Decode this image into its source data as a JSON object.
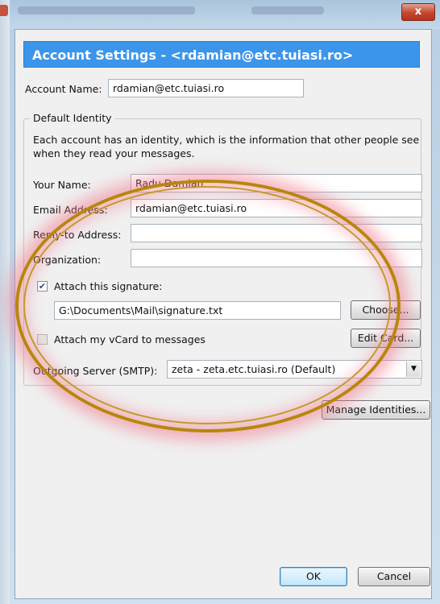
{
  "window": {
    "close_glyph": "x"
  },
  "dialog": {
    "header": "Account Settings - <rdamian@etc.tuiasi.ro>",
    "account_name_label": "Account Name:",
    "account_name_value": "rdamian@etc.tuiasi.ro",
    "identity_legend": "Default Identity",
    "identity_description": "Each account has an identity, which is the information that other people see when they read your messages.",
    "your_name_label": "Your Name:",
    "your_name_value": "Radu Damian",
    "email_label": "Email Address:",
    "email_value": "rdamian@etc.tuiasi.ro",
    "reply_to_label": "Reply-to Address:",
    "reply_to_value": "",
    "organization_label": "Organization:",
    "organization_value": "",
    "attach_signature_label": "Attach this signature:",
    "attach_signature_checked": true,
    "signature_path": "G:\\Documents\\Mail\\signature.txt",
    "choose_button": "Choose...",
    "attach_vcard_label": "Attach my vCard to messages",
    "attach_vcard_checked": false,
    "edit_card_button": "Edit Card...",
    "smtp_label": "Outgoing Server (SMTP):",
    "smtp_value": "zeta - zeta.etc.tuiasi.ro (Default)",
    "manage_identities_button": "Manage Identities...",
    "ok_button": "OK",
    "cancel_button": "Cancel"
  },
  "colors": {
    "header_bg": "#3b95ea",
    "annotation_ring": "#b8860b",
    "annotation_glow": "#f0788c"
  }
}
